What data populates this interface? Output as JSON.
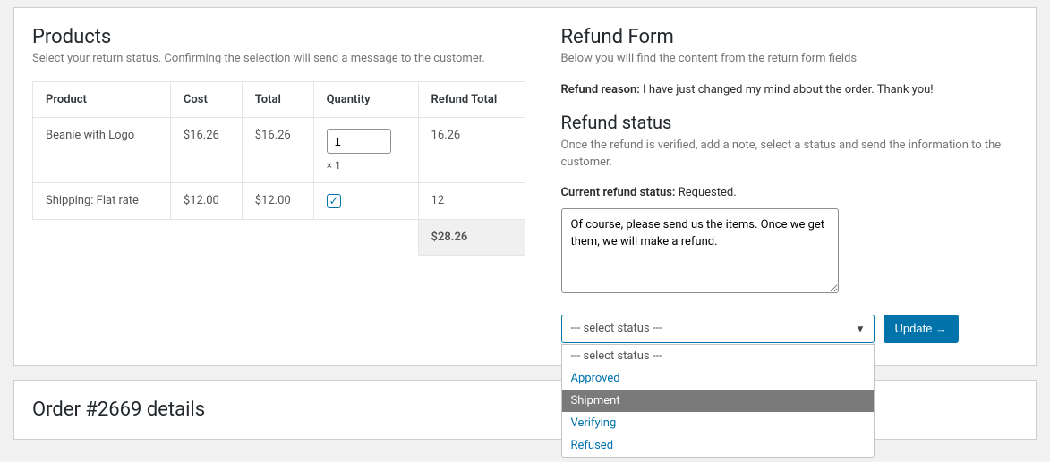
{
  "products": {
    "title": "Products",
    "subtext": "Select your return status. Confirming the selection will send a message to the customer.",
    "headers": {
      "product": "Product",
      "cost": "Cost",
      "total": "Total",
      "quantity": "Quantity",
      "refund_total": "Refund Total"
    },
    "rows": [
      {
        "product": "Beanie with Logo",
        "cost": "$16.26",
        "total_col": "$16.26",
        "quantity_value": "1",
        "quantity_mult": "× 1",
        "refund_total": "16.26"
      },
      {
        "product": "Shipping: Flat rate",
        "cost": "$12.00",
        "total_col": "$12.00",
        "checkbox_checked": true,
        "refund_total": "12"
      }
    ],
    "grand_total": "$28.26"
  },
  "refund_form": {
    "title": "Refund Form",
    "subtext": "Below you will find the content from the return form fields",
    "reason_label": "Refund reason:",
    "reason_text": " I have just changed my mind about the order. Thank you!",
    "status_title": "Refund status",
    "status_desc": "Once the refund is verified, add a note, select a status and send the information to the customer.",
    "current_status_label": "Current refund status: ",
    "current_status_value": "Requested.",
    "note_text": "Of course, please send us the items. Once we get them, we will make a refund.",
    "select_placeholder": "--- select status ---",
    "options": {
      "default": "--- select status ---",
      "approved": "Approved",
      "shipment": "Shipment",
      "verifying": "Verifying",
      "refused": "Refused"
    },
    "update_button": "Update →"
  },
  "order_box": {
    "title": "Order #2669 details"
  }
}
